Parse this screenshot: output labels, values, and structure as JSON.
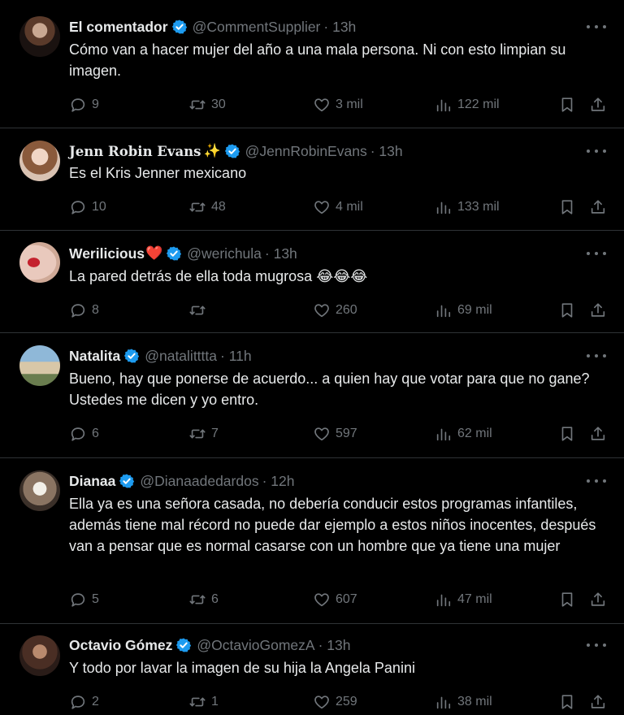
{
  "icons": {
    "reply": "reply-icon",
    "retweet": "retweet-icon",
    "like": "heart-icon",
    "views": "views-icon",
    "bookmark": "bookmark-icon",
    "share": "share-icon",
    "more": "more-icon",
    "verified": "verified-badge-icon"
  },
  "colors": {
    "background": "#000000",
    "text": "#e7e9ea",
    "muted": "#71767b",
    "verified": "#1d9bf0",
    "border": "#2f3336"
  },
  "tweets": [
    {
      "name": "El comentador",
      "handle": "@CommentSupplier",
      "time": "· 13h",
      "text": "Cómo van a hacer mujer del año a una mala persona. Ni con esto limpian su imagen.",
      "replies": "9",
      "retweets": "30",
      "likes": "3 mil",
      "views": "122 mil"
    },
    {
      "name": "Jenn Robin Evans",
      "name_emoji": "✨",
      "handle": "@JennRobinEvans",
      "time": "· 13h",
      "text": "Es el Kris Jenner mexicano",
      "replies": "10",
      "retweets": "48",
      "likes": "4 mil",
      "views": "133 mil"
    },
    {
      "name": "Werilicious",
      "name_emoji": "❤️",
      "handle": "@werichula",
      "time": "· 13h",
      "text": "La pared detrás de ella toda mugrosa 😂😂😂",
      "replies": "8",
      "retweets": "",
      "likes": "260",
      "views": "69 mil"
    },
    {
      "name": "Natalita",
      "handle": "@natalitttta",
      "time": "· 11h",
      "text": "Bueno, hay que ponerse de acuerdo... a quien hay que votar para que no gane? Ustedes me dicen y yo entro.",
      "replies": "6",
      "retweets": "7",
      "likes": "597",
      "views": "62 mil"
    },
    {
      "name": "Dianaa",
      "handle": "@Dianaadedardos",
      "time": "· 12h",
      "text": "Ella ya es una señora casada, no debería conducir estos programas infantiles, además tiene mal récord no puede dar ejemplo a estos niños inocentes, después van a pensar que es normal casarse con un hombre que ya tiene una mujer",
      "replies": "5",
      "retweets": "6",
      "likes": "607",
      "views": "47 mil"
    },
    {
      "name": "Octavio Gómez",
      "handle": "@OctavioGomezA",
      "time": "· 13h",
      "text": "Y todo por lavar la imagen de su hija la Angela Panini",
      "replies": "2",
      "retweets": "1",
      "likes": "259",
      "views": "38 mil"
    }
  ]
}
